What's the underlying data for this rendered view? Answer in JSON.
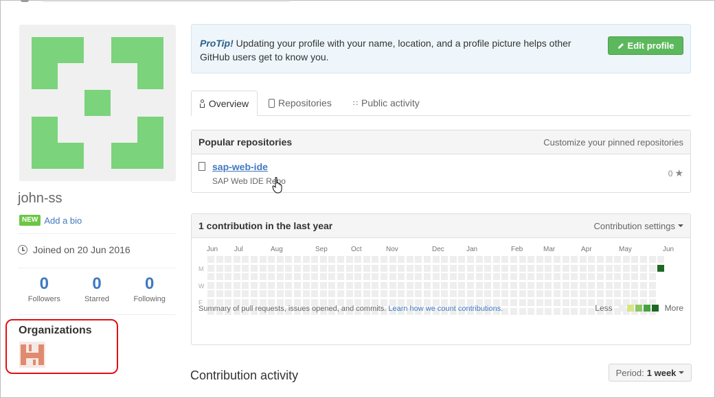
{
  "profile": {
    "username": "john-ss",
    "new_badge": "NEW",
    "add_bio": "Add a bio",
    "joined": "Joined on 20 Jun 2016",
    "stats": [
      {
        "value": "0",
        "label": "Followers"
      },
      {
        "value": "0",
        "label": "Starred"
      },
      {
        "value": "0",
        "label": "Following"
      }
    ],
    "organizations_title": "Organizations",
    "avatar_color": "#7bd37b",
    "org_avatar_color": "#e08a6f"
  },
  "protip": {
    "strong": "ProTip!",
    "text": " Updating your profile with your name, location, and a profile picture helps other GitHub users get to know you.",
    "edit_button": "Edit profile"
  },
  "tabs": [
    {
      "label": "Overview",
      "icon": "person-icon",
      "active": true
    },
    {
      "label": "Repositories",
      "icon": "repo-icon",
      "active": false
    },
    {
      "label": "Public activity",
      "icon": "rss-icon",
      "active": false
    }
  ],
  "popular": {
    "title": "Popular repositories",
    "customize": "Customize your pinned repositories",
    "repos": [
      {
        "name": "sap-web-ide",
        "description": "SAP Web IDE Repo",
        "stars": "0"
      }
    ]
  },
  "contributions": {
    "title": "1 contribution in the last year",
    "settings": "Contribution settings",
    "months": [
      "Jun",
      "Jul",
      "Aug",
      "Sep",
      "Oct",
      "Nov",
      "Dec",
      "Jan",
      "Feb",
      "Mar",
      "Apr",
      "May",
      "Jun"
    ],
    "day_labels": [
      "M",
      "W",
      "F"
    ],
    "summary_text": "Summary of pull requests, issues opened, and commits.",
    "summary_link": "Learn how we count contributions.",
    "legend_less": "Less",
    "legend_more": "More",
    "legend_colors": [
      "#eeeeee",
      "#d6e685",
      "#8cc665",
      "#44a340",
      "#1e6823"
    ],
    "weeks": 53,
    "active_week": 52,
    "active_day": 1
  },
  "activity": {
    "title": "Contribution activity",
    "period_label": "Period:",
    "period_value": "1 week"
  }
}
